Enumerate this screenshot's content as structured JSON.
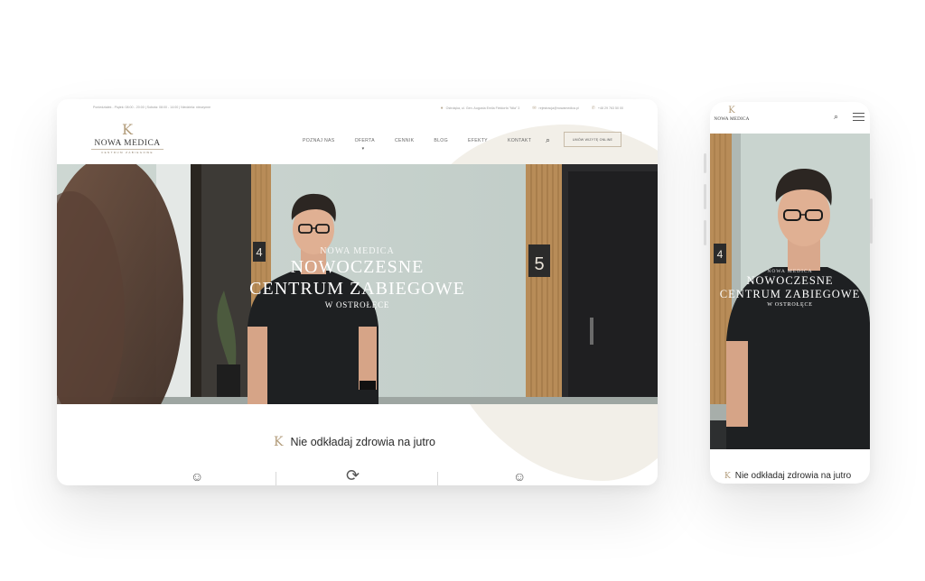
{
  "desktop": {
    "topbar": {
      "left_text": "Poniedziałek - Piątek: 08:00 - 20:00 | Sobota: 08:00 - 14:00 | Niedziela: nieczynne",
      "address": "Ostrołęka, ul. Gen. Augusta Emila Fieldorfa \"Nila\" 3",
      "email": "rejestracja@nowamedica.pl",
      "phone": "+48 29 763 50 00"
    },
    "logo": {
      "mark": "K",
      "name": "NOWA MEDICA",
      "sub": "CENTRUM ZABIEGOWE"
    },
    "nav": [
      "POZNAJ NAS",
      "OFERTA",
      "CENNIK",
      "BLOG",
      "EFEKTY",
      "KONTAKT"
    ],
    "book_button": "UMÓW WIZYTĘ ONLINE",
    "hero": {
      "pre": "NOWA MEDICA",
      "line1": "NOWOCZESNE",
      "line2": "CENTRUM ZABIEGOWE",
      "sub": "W OSTROŁĘCE",
      "door_number_left": "4",
      "door_number_right": "5"
    },
    "tagline": "Nie odkładaj zdrowia na jutro",
    "features_icons": [
      "face-icon",
      "refresh-icon",
      "face-icon"
    ]
  },
  "mobile": {
    "logo": {
      "mark": "K",
      "name": "NOWA MEDICA"
    },
    "hero": {
      "pre": "NOWA MEDICA",
      "line1": "NOWOCZESNE",
      "line2": "CENTRUM ZABIEGOWE",
      "sub": "W OSTROŁĘCE",
      "door_number": "4"
    },
    "tagline": "Nie odkładaj zdrowia na jutro"
  },
  "colors": {
    "accent": "#b39d7c",
    "hero_wall": "#c7d2cd",
    "wood": "#b88c58",
    "scrubs": "#1e2022",
    "blob": "#f2efe8"
  }
}
